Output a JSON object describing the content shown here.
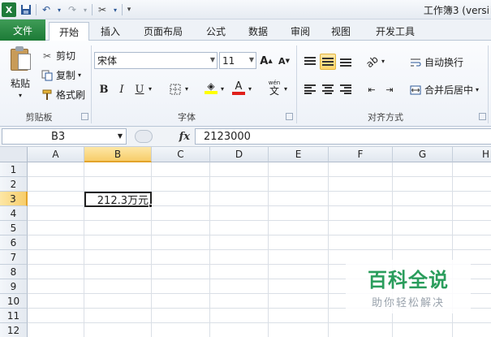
{
  "window": {
    "title": "工作簿3 (versi"
  },
  "quick_access": {
    "icons": [
      "excel-logo",
      "save-icon",
      "undo-icon",
      "redo-icon",
      "customize-icon"
    ],
    "logo_text": "X"
  },
  "tabs": [
    {
      "label": "文件"
    },
    {
      "label": "开始"
    },
    {
      "label": "插入"
    },
    {
      "label": "页面布局"
    },
    {
      "label": "公式"
    },
    {
      "label": "数据"
    },
    {
      "label": "审阅"
    },
    {
      "label": "视图"
    },
    {
      "label": "开发工具"
    }
  ],
  "clipboard": {
    "paste_label": "粘贴",
    "cut_label": "剪切",
    "copy_label": "复制",
    "format_painter_label": "格式刷",
    "group_label": "剪贴板"
  },
  "font": {
    "font_name": "宋体",
    "font_size": "11",
    "grow_label": "A",
    "shrink_label": "A",
    "bold_label": "B",
    "italic_label": "I",
    "underline_label": "U",
    "font_color_label": "A",
    "phonetic_label": "wén",
    "phonetic_char": "文",
    "group_label": "字体",
    "fill_color": "#ffff00",
    "font_color": "#e0201b"
  },
  "alignment": {
    "wrap_label": "自动换行",
    "merge_label": "合并后居中",
    "group_label": "对齐方式"
  },
  "formula_bar": {
    "name_box": "B3",
    "fx_label": "fx",
    "formula": "2123000"
  },
  "sheet": {
    "columns": [
      "A",
      "B",
      "C",
      "D",
      "E",
      "F",
      "G",
      "H"
    ],
    "rows": [
      "1",
      "2",
      "3",
      "4",
      "5",
      "6",
      "7",
      "8",
      "9",
      "10",
      "11",
      "12"
    ],
    "selected_column": "B",
    "selected_row": "3",
    "active_cell_value": "212.3万元"
  },
  "watermark": {
    "main": "百科全说",
    "sub": "助你轻松解决"
  }
}
